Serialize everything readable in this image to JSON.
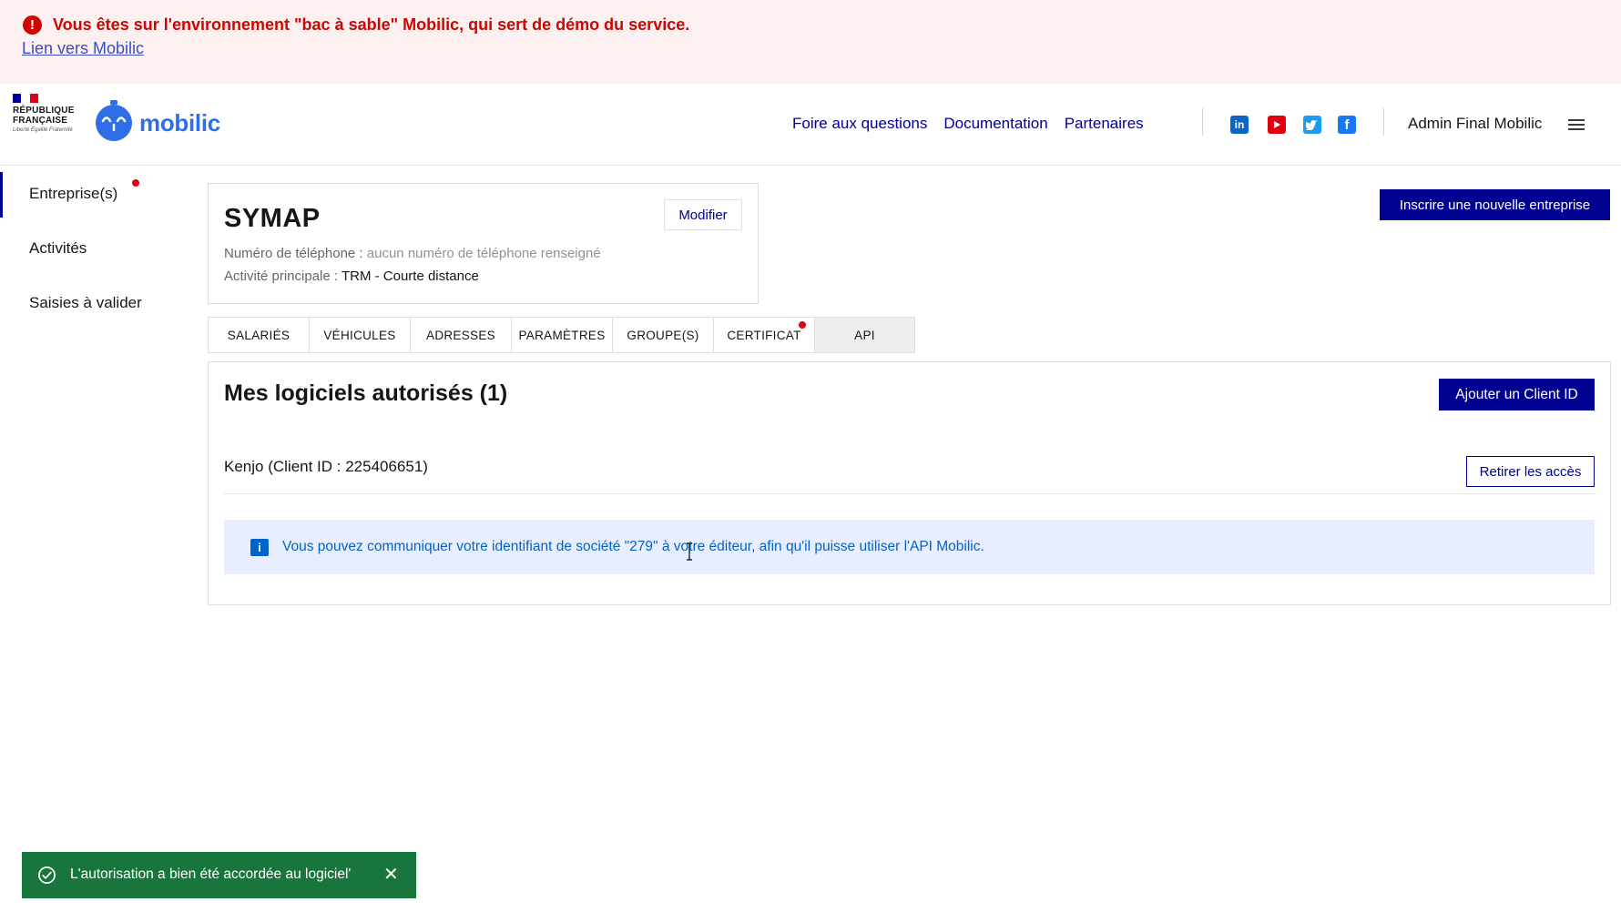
{
  "banner": {
    "message": "Vous êtes sur l'environnement \"bac à sable\" Mobilic, qui sert de démo du service.",
    "link": "Lien vers Mobilic"
  },
  "header": {
    "gov_title_1": "RÉPUBLIQUE",
    "gov_title_2": "FRANÇAISE",
    "gov_motto": "Liberté Égalité Fraternité",
    "brand": "mobilic",
    "nav": [
      "Foire aux questions",
      "Documentation",
      "Partenaires"
    ],
    "social": [
      "linkedin-icon",
      "youtube-icon",
      "twitter-icon",
      "facebook-icon"
    ],
    "user": "Admin Final Mobilic"
  },
  "sidebar": {
    "items": [
      {
        "label": "Entreprise(s)"
      },
      {
        "label": "Activités"
      },
      {
        "label": "Saisies à valider"
      }
    ]
  },
  "company": {
    "name": "SYMAP",
    "modify_label": "Modifier",
    "phone_label": "Numéro de téléphone : ",
    "phone_value": "aucun numéro de téléphone renseigné",
    "activity_label": "Activité principale : ",
    "activity_value": "TRM - Courte distance"
  },
  "new_company_button": "Inscrire une nouvelle entreprise",
  "tabs": [
    {
      "label": "SALARIÉS"
    },
    {
      "label": "VÉHICULES"
    },
    {
      "label": "ADRESSES"
    },
    {
      "label": "PARAMÈTRES"
    },
    {
      "label": "GROUPE(S)"
    },
    {
      "label": "CERTIFICAT"
    },
    {
      "label": "API"
    }
  ],
  "api_panel": {
    "title": "Mes logiciels autorisés (1)",
    "add_client_button": "Ajouter un Client ID",
    "client_row": "Kenjo (Client ID : 225406651)",
    "revoke_button": "Retirer les accès",
    "info_text": "Vous pouvez communiquer votre identifiant de société \"279\" à votre éditeur, afin qu'il puisse utiliser l'API Mobilic."
  },
  "toast": {
    "message": "L'autorisation a bien été accordée au logiciel'"
  },
  "colors": {
    "primary": "#000091",
    "alert": "#ce0500",
    "success": "#18753c",
    "info": "#0063cb",
    "brand": "#2e6ee6"
  }
}
